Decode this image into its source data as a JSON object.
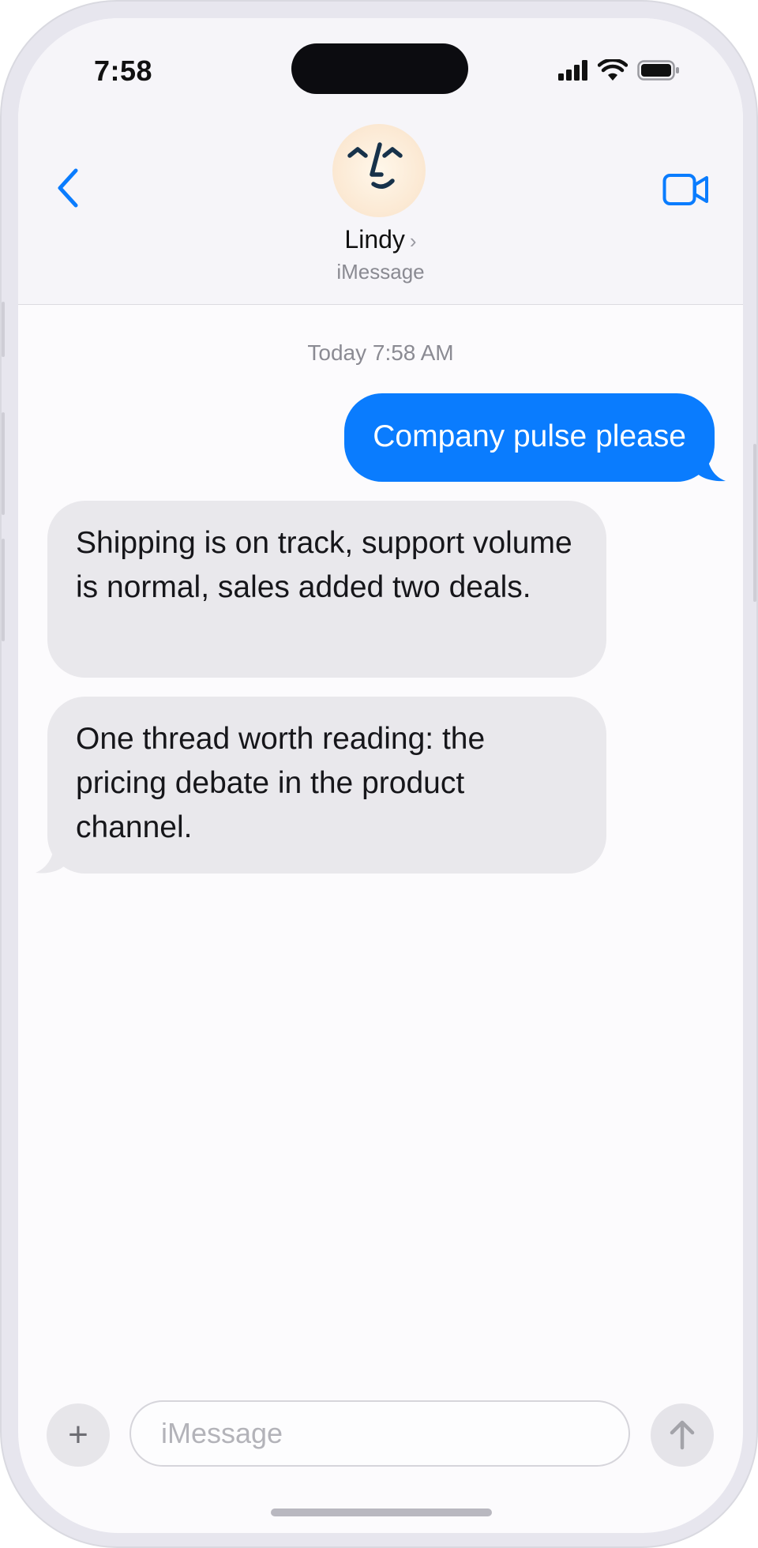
{
  "status_bar": {
    "time": "7:58"
  },
  "header": {
    "contact_name": "Lindy",
    "contact_chevron": "›",
    "service": "iMessage",
    "back_icon": "chevron-left-icon",
    "video_icon": "video-camera-icon"
  },
  "conversation": {
    "timestamp": "Today 7:58 AM",
    "messages": [
      {
        "direction": "outgoing",
        "text": "Company pulse please"
      },
      {
        "direction": "incoming",
        "text": "Shipping is on track, support volume is normal, sales added two deals."
      },
      {
        "direction": "incoming",
        "text": "One thread worth reading: the pricing debate in the product channel."
      }
    ]
  },
  "composer": {
    "plus_label": "+",
    "placeholder": "iMessage",
    "send_icon": "arrow-up-icon"
  },
  "colors": {
    "accent": "#0a7cfe",
    "incoming_bubble": "#e9e8ec",
    "header_bg": "#f6f5f9"
  }
}
